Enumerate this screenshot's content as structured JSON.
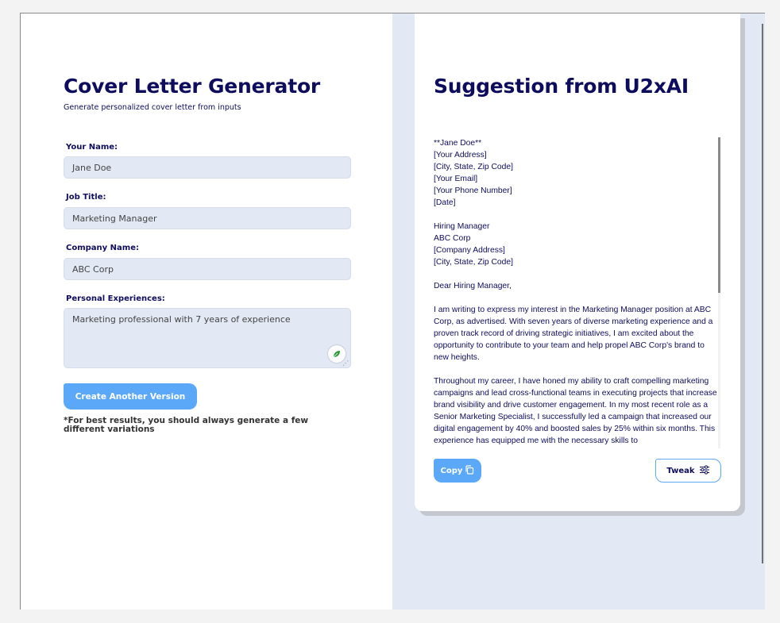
{
  "generator": {
    "title": "Cover Letter Generator",
    "subtitle": "Generate personalized cover letter from inputs",
    "fields": {
      "name": {
        "label": "Your Name:",
        "value": "Jane Doe"
      },
      "job_title": {
        "label": "Job Title:",
        "value": "Marketing Manager"
      },
      "company": {
        "label": "Company Name:",
        "value": "ABC Corp"
      },
      "experiences": {
        "label": "Personal Experiences:",
        "value": "Marketing professional with 7 years of experience"
      }
    },
    "create_button": "Create Another Version",
    "note": "*For best results, you should always generate a few different variations"
  },
  "suggestion": {
    "title": "Suggestion from U2xAI",
    "letter": [
      "**Jane Doe**\n[Your Address]\n[City, State, Zip Code]\n[Your Email]\n[Your Phone Number]\n[Date]",
      "Hiring Manager\nABC Corp\n[Company Address]\n[City, State, Zip Code]",
      "Dear Hiring Manager,",
      "I am writing to express my interest in the Marketing Manager position at ABC Corp, as advertised. With seven years of diverse marketing experience and a proven track record of driving strategic initiatives, I am excited about the opportunity to contribute to your team and help propel ABC Corp's brand to new heights.",
      "Throughout my career, I have honed my ability to craft compelling marketing campaigns and lead cross-functional teams in executing projects that increase brand visibility and drive customer engagement. In my most recent role as a Senior Marketing Specialist, I successfully led a campaign that increased our digital engagement by 40% and boosted sales by 25% within six months. This experience has equipped me with the necessary skills to"
    ],
    "copy_button": "Copy",
    "tweak_button": "Tweak"
  },
  "icons": {
    "copy": "copy-icon",
    "tweak": "sliders-icon",
    "assist": "leaf-icon"
  }
}
